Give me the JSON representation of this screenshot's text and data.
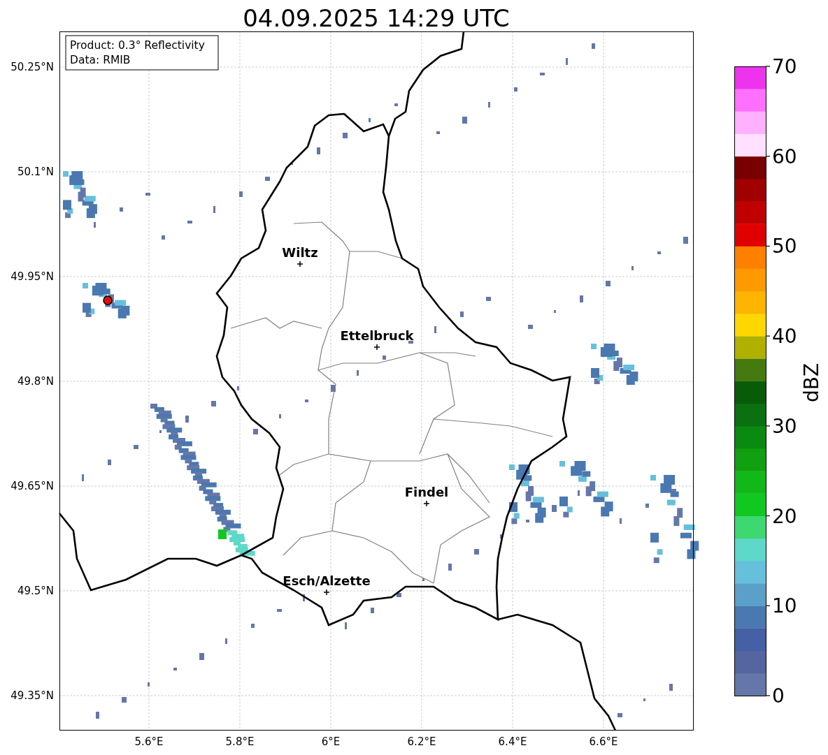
{
  "title": "04.09.2025 14:29 UTC",
  "info_box": {
    "lines": [
      "Product: 0.3° Reflectivity",
      "Data: RMIB"
    ]
  },
  "y_axis": {
    "ticks": [
      "50.25°N",
      "50.1°N",
      "49.95°N",
      "49.8°N",
      "49.65°N",
      "49.5°N",
      "49.35°N"
    ]
  },
  "x_axis": {
    "ticks": [
      "5.6°E",
      "5.8°E",
      "6°E",
      "6.2°E",
      "6.4°E",
      "6.6°E"
    ]
  },
  "cities": [
    "Wiltz",
    "Ettelbruck",
    "Findel",
    "Esch/Alzette"
  ],
  "colorbar": {
    "label": "dBZ",
    "ticks": [
      "70",
      "60",
      "50",
      "40",
      "30",
      "20",
      "10",
      "0"
    ],
    "bins": [
      {
        "color": "#6577a8"
      },
      {
        "color": "#5565a0"
      },
      {
        "color": "#4560a5"
      },
      {
        "color": "#4a78b0"
      },
      {
        "color": "#5aa0c8"
      },
      {
        "color": "#66c0dc"
      },
      {
        "color": "#5ed8c8"
      },
      {
        "color": "#3dd870"
      },
      {
        "color": "#10c820"
      },
      {
        "color": "#12b818"
      },
      {
        "color": "#10a010"
      },
      {
        "color": "#0a8a10"
      },
      {
        "color": "#0a7010"
      },
      {
        "color": "#085c08"
      },
      {
        "color": "#447a10"
      },
      {
        "color": "#b0b000"
      },
      {
        "color": "#ffd700"
      },
      {
        "color": "#ffb400"
      },
      {
        "color": "#ff9900"
      },
      {
        "color": "#ff7f00"
      },
      {
        "color": "#e00000"
      },
      {
        "color": "#c00000"
      },
      {
        "color": "#a00000"
      },
      {
        "color": "#780000"
      },
      {
        "color": "#ffe0ff"
      },
      {
        "color": "#ffb0ff"
      },
      {
        "color": "#ff70ff"
      },
      {
        "color": "#ee33ee"
      }
    ]
  }
}
